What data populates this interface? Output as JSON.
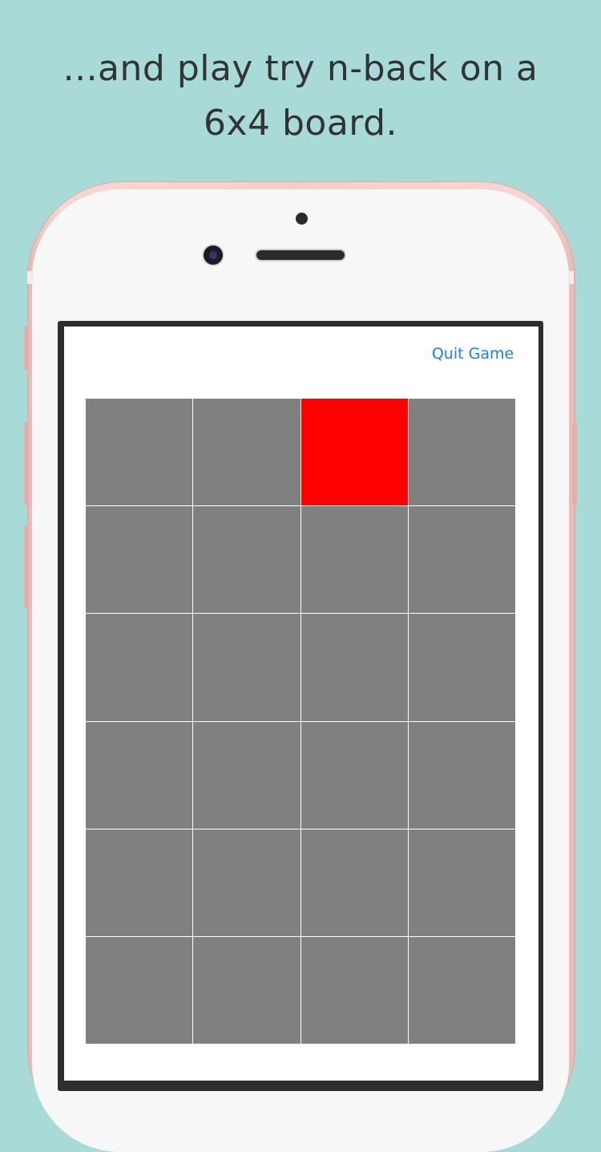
{
  "caption": "...and play try n-back on a 6x4 board.",
  "game": {
    "quit_label": "Quit Game",
    "rows": 6,
    "cols": 4,
    "active_cell": {
      "row": 0,
      "col": 2
    },
    "colors": {
      "cell": "#808080",
      "active": "#ff0000",
      "link": "#1e7ff0"
    }
  }
}
